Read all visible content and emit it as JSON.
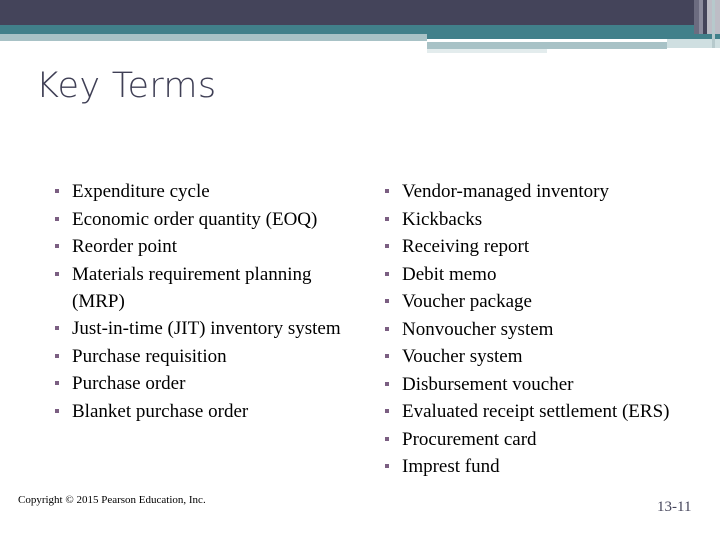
{
  "slide": {
    "title": "Key Terms",
    "theme": {
      "header_dark": "#44445a",
      "header_teal": "#41808a",
      "header_light": "#a8c2c6",
      "bullet_color": "#7b5f82",
      "title_color": "#3f3f55",
      "body_text_color": "#000000",
      "background": "#ffffff"
    }
  },
  "columns": {
    "left": {
      "items": [
        "Expenditure cycle",
        "Economic order quantity (EOQ)",
        "Reorder point",
        "Materials requirement planning (MRP)",
        "Just-in-time (JIT) inventory system",
        "Purchase requisition",
        "Purchase order",
        "Blanket purchase order"
      ]
    },
    "right": {
      "items": [
        "Vendor-managed inventory",
        "Kickbacks",
        "Receiving report",
        "Debit memo",
        "Voucher package",
        "Nonvoucher system",
        "Voucher system",
        "Disbursement voucher",
        "Evaluated receipt settlement (ERS)",
        "Procurement card",
        "Imprest fund"
      ]
    }
  },
  "footer": {
    "copyright": "Copyright © 2015 Pearson Education, Inc.",
    "page_number": "13-11"
  }
}
